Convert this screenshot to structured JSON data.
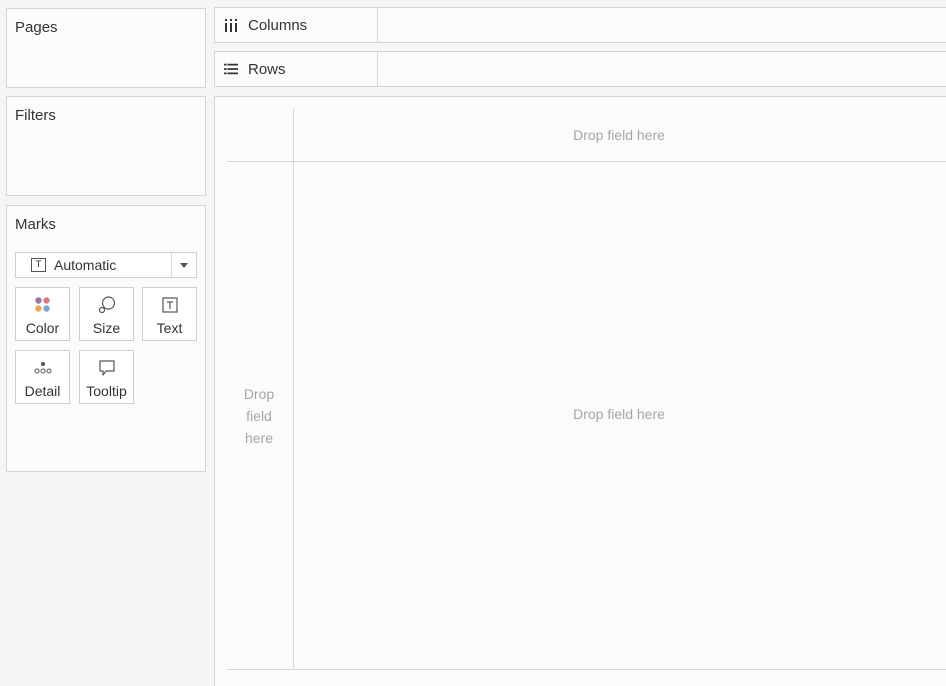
{
  "pages": {
    "title": "Pages"
  },
  "filters": {
    "title": "Filters"
  },
  "marks": {
    "title": "Marks",
    "mark_type": "Automatic",
    "buttons": {
      "color": "Color",
      "size": "Size",
      "text": "Text",
      "detail": "Detail",
      "tooltip": "Tooltip"
    },
    "color_dots": [
      "#8e7aa8",
      "#e07a7a",
      "#f0a35c",
      "#7aa6d4"
    ]
  },
  "shelves": {
    "columns": "Columns",
    "rows": "Rows"
  },
  "view": {
    "columns_drop": "Drop field here",
    "rows_drop_line1": "Drop",
    "rows_drop_line2": "field",
    "rows_drop_line3": "here",
    "main_drop": "Drop field here"
  }
}
